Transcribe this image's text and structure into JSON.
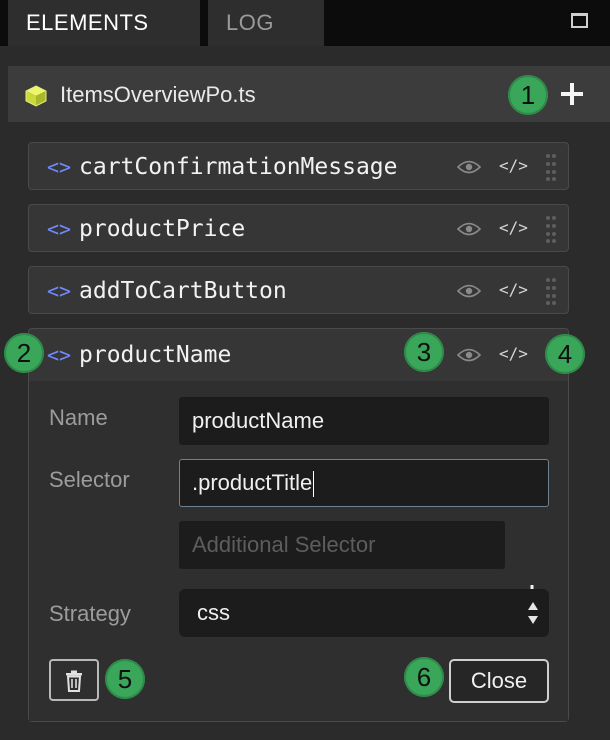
{
  "tabs": {
    "elements": "ELEMENTS",
    "log": "LOG"
  },
  "file": {
    "name": "ItemsOverviewPo.ts",
    "icon": "cube-icon"
  },
  "elements": [
    {
      "name": "cartConfirmationMessage"
    },
    {
      "name": "productPrice"
    },
    {
      "name": "addToCartButton"
    }
  ],
  "expanded": {
    "name": "productName",
    "form": {
      "name_label": "Name",
      "name_value": "productName",
      "selector_label": "Selector",
      "selector_value": ".productTitle",
      "additional_placeholder": "Additional Selector",
      "strategy_label": "Strategy",
      "strategy_value": "css"
    },
    "close_label": "Close"
  },
  "row_icons": {
    "toggle": "code-brackets-icon",
    "code_text": "</>"
  },
  "badges": [
    "1",
    "2",
    "3",
    "4",
    "5",
    "6"
  ],
  "colors": {
    "badge": "#3aa65a",
    "accent": "#6f8cff",
    "cube": "#d6e84a"
  }
}
